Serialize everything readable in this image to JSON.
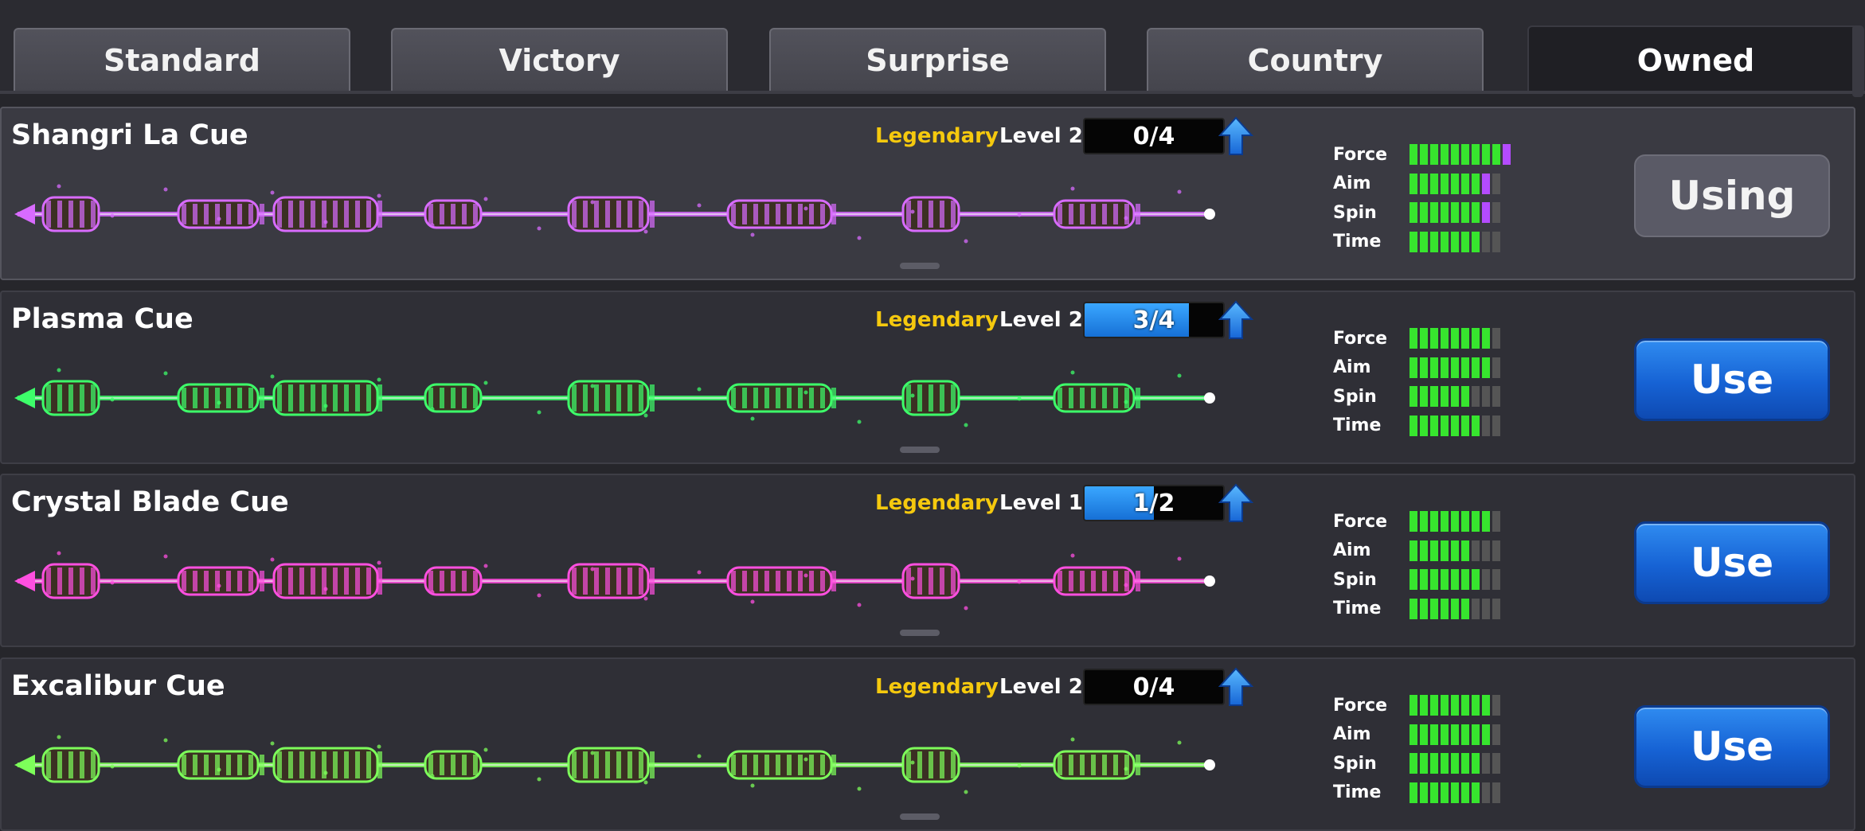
{
  "tabs": [
    {
      "label": "Standard"
    },
    {
      "label": "Victory"
    },
    {
      "label": "Surprise"
    },
    {
      "label": "Country"
    },
    {
      "label": "Owned"
    }
  ],
  "stat_labels": [
    "Force",
    "Aim",
    "Spin",
    "Time"
  ],
  "cues": [
    {
      "name": "Shangri La Cue",
      "rarity": "Legendary",
      "level": "Level 2",
      "progress_text": "0/4",
      "progress_fraction": 0.0,
      "stats": [
        {
          "label": "Force",
          "filled": 9,
          "upgrade": 1,
          "total": 10
        },
        {
          "label": "Aim",
          "filled": 7,
          "upgrade": 1,
          "total": 9
        },
        {
          "label": "Spin",
          "filled": 7,
          "upgrade": 1,
          "total": 9
        },
        {
          "label": "Time",
          "filled": 7,
          "upgrade": 0,
          "total": 9
        }
      ],
      "button_label": "Using",
      "button_state": "using",
      "accent": "#d86bff"
    },
    {
      "name": "Plasma Cue",
      "rarity": "Legendary",
      "level": "Level 2",
      "progress_text": "3/4",
      "progress_fraction": 0.75,
      "stats": [
        {
          "label": "Force",
          "filled": 8,
          "upgrade": 0,
          "total": 9
        },
        {
          "label": "Aim",
          "filled": 8,
          "upgrade": 0,
          "total": 9
        },
        {
          "label": "Spin",
          "filled": 6,
          "upgrade": 0,
          "total": 9
        },
        {
          "label": "Time",
          "filled": 7,
          "upgrade": 0,
          "total": 9
        }
      ],
      "button_label": "Use",
      "button_state": "use",
      "accent": "#3dff6a"
    },
    {
      "name": "Crystal Blade Cue",
      "rarity": "Legendary",
      "level": "Level 1",
      "progress_text": "1/2",
      "progress_fraction": 0.5,
      "stats": [
        {
          "label": "Force",
          "filled": 8,
          "upgrade": 0,
          "total": 9
        },
        {
          "label": "Aim",
          "filled": 6,
          "upgrade": 0,
          "total": 9
        },
        {
          "label": "Spin",
          "filled": 7,
          "upgrade": 0,
          "total": 9
        },
        {
          "label": "Time",
          "filled": 6,
          "upgrade": 0,
          "total": 9
        }
      ],
      "button_label": "Use",
      "button_state": "use",
      "accent": "#ff4fe0"
    },
    {
      "name": "Excalibur Cue",
      "rarity": "Legendary",
      "level": "Level 2",
      "progress_text": "0/4",
      "progress_fraction": 0.0,
      "stats": [
        {
          "label": "Force",
          "filled": 8,
          "upgrade": 0,
          "total": 9
        },
        {
          "label": "Aim",
          "filled": 8,
          "upgrade": 0,
          "total": 9
        },
        {
          "label": "Spin",
          "filled": 7,
          "upgrade": 0,
          "total": 9
        },
        {
          "label": "Time",
          "filled": 7,
          "upgrade": 0,
          "total": 9
        }
      ],
      "button_label": "Use",
      "button_state": "use",
      "accent": "#7dff5a"
    }
  ],
  "colors": {
    "rarity": "#f5c90e",
    "stat_on": "#37e52e",
    "stat_upgrade": "#b44bff",
    "button_blue": "#1662d4"
  }
}
